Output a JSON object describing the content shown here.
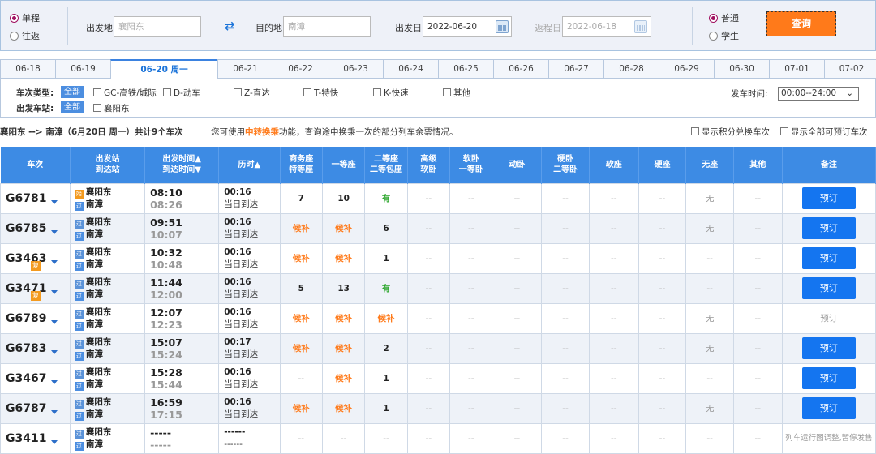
{
  "search": {
    "trip_oneway": "单程",
    "trip_round": "往返",
    "from_label": "出发地",
    "from_value": "襄阳东",
    "to_label": "目的地",
    "to_value": "南漳",
    "depart_label": "出发日",
    "depart_value": "2022-06-20",
    "return_label": "返程日",
    "return_value": "2022-06-18",
    "passenger_normal": "普通",
    "passenger_student": "学生",
    "query_label": "查询"
  },
  "dates": [
    "06-18",
    "06-19",
    "06-20 周一",
    "06-21",
    "06-22",
    "06-23",
    "06-24",
    "06-25",
    "06-26",
    "06-27",
    "06-28",
    "06-29",
    "06-30",
    "07-01",
    "07-02"
  ],
  "filters": {
    "type_label": "车次类型:",
    "all": "全部",
    "types": [
      "GC-高铁/城际",
      "D-动车",
      "Z-直达",
      "T-特快",
      "K-快速",
      "其他"
    ],
    "station_label": "出发车站:",
    "stations": [
      "襄阳东"
    ],
    "time_label": "发车时间:",
    "time_value": "00:00--24:00"
  },
  "info": {
    "route": "襄阳东 --> 南漳（6月20日 周一）共计",
    "count": "9",
    "count_suffix": "个车次",
    "tip_pre": "您可使用",
    "tip_link": "中转换乘",
    "tip_post": "功能，查询途中换乘一次的部分列车余票情况。",
    "opt1": "显示积分兑换车次",
    "opt2": "显示全部可预订车次"
  },
  "headers": {
    "train": "车次",
    "station1": "出发站",
    "station2": "到达站",
    "time1": "出发时间▲",
    "time2": "到达时间▼",
    "duration": "历时▲",
    "business1": "商务座",
    "business2": "特等座",
    "first": "一等座",
    "second1": "二等座",
    "second2": "二等包座",
    "gr1": "高级",
    "gr2": "软卧",
    "sw1": "软卧",
    "sw2": "一等卧",
    "dw": "动卧",
    "hw1": "硬卧",
    "hw2": "二等卧",
    "rz": "软座",
    "yz": "硬座",
    "wz": "无座",
    "other": "其他",
    "remark": "备注"
  },
  "icons": {
    "start": "始",
    "pass": "过",
    "fu": "复"
  },
  "rows": [
    {
      "no": "G6781",
      "fu": false,
      "from": "襄阳东",
      "from_type": "start",
      "to": "南漳",
      "dep": "08:10",
      "arr": "08:26",
      "dur": "00:16",
      "day": "当日到达",
      "biz": "7",
      "first": "10",
      "second": "有",
      "gr": "--",
      "sw": "--",
      "dw": "--",
      "hw": "--",
      "rz": "--",
      "yz": "--",
      "wz": "无",
      "other": "--",
      "book": "预订",
      "bookable": true
    },
    {
      "no": "G6785",
      "fu": false,
      "from": "襄阳东",
      "from_type": "pass",
      "to": "南漳",
      "dep": "09:51",
      "arr": "10:07",
      "dur": "00:16",
      "day": "当日到达",
      "biz": "候补",
      "first": "候补",
      "second": "6",
      "gr": "--",
      "sw": "--",
      "dw": "--",
      "hw": "--",
      "rz": "--",
      "yz": "--",
      "wz": "无",
      "other": "--",
      "book": "预订",
      "bookable": true
    },
    {
      "no": "G3463",
      "fu": true,
      "from": "襄阳东",
      "from_type": "pass",
      "to": "南漳",
      "dep": "10:32",
      "arr": "10:48",
      "dur": "00:16",
      "day": "当日到达",
      "biz": "候补",
      "first": "候补",
      "second": "1",
      "gr": "--",
      "sw": "--",
      "dw": "--",
      "hw": "--",
      "rz": "--",
      "yz": "--",
      "wz": "--",
      "other": "--",
      "book": "预订",
      "bookable": true
    },
    {
      "no": "G3471",
      "fu": true,
      "from": "襄阳东",
      "from_type": "pass",
      "to": "南漳",
      "dep": "11:44",
      "arr": "12:00",
      "dur": "00:16",
      "day": "当日到达",
      "biz": "5",
      "first": "13",
      "second": "有",
      "gr": "--",
      "sw": "--",
      "dw": "--",
      "hw": "--",
      "rz": "--",
      "yz": "--",
      "wz": "--",
      "other": "--",
      "book": "预订",
      "bookable": true
    },
    {
      "no": "G6789",
      "fu": false,
      "from": "襄阳东",
      "from_type": "pass",
      "to": "南漳",
      "dep": "12:07",
      "arr": "12:23",
      "dur": "00:16",
      "day": "当日到达",
      "biz": "候补",
      "first": "候补",
      "second": "候补",
      "gr": "--",
      "sw": "--",
      "dw": "--",
      "hw": "--",
      "rz": "--",
      "yz": "--",
      "wz": "无",
      "other": "--",
      "book": "预订",
      "bookable": false
    },
    {
      "no": "G6783",
      "fu": false,
      "from": "襄阳东",
      "from_type": "pass",
      "to": "南漳",
      "dep": "15:07",
      "arr": "15:24",
      "dur": "00:17",
      "day": "当日到达",
      "biz": "候补",
      "first": "候补",
      "second": "2",
      "gr": "--",
      "sw": "--",
      "dw": "--",
      "hw": "--",
      "rz": "--",
      "yz": "--",
      "wz": "无",
      "other": "--",
      "book": "预订",
      "bookable": true
    },
    {
      "no": "G3467",
      "fu": false,
      "from": "襄阳东",
      "from_type": "pass",
      "to": "南漳",
      "dep": "15:28",
      "arr": "15:44",
      "dur": "00:16",
      "day": "当日到达",
      "biz": "--",
      "first": "候补",
      "second": "1",
      "gr": "--",
      "sw": "--",
      "dw": "--",
      "hw": "--",
      "rz": "--",
      "yz": "--",
      "wz": "--",
      "other": "--",
      "book": "预订",
      "bookable": true
    },
    {
      "no": "G6787",
      "fu": false,
      "from": "襄阳东",
      "from_type": "pass",
      "to": "南漳",
      "dep": "16:59",
      "arr": "17:15",
      "dur": "00:16",
      "day": "当日到达",
      "biz": "候补",
      "first": "候补",
      "second": "1",
      "gr": "--",
      "sw": "--",
      "dw": "--",
      "hw": "--",
      "rz": "--",
      "yz": "--",
      "wz": "无",
      "other": "--",
      "book": "预订",
      "bookable": true
    },
    {
      "no": "G3411",
      "fu": false,
      "from": "襄阳东",
      "from_type": "pass",
      "to": "南漳",
      "dep": "-----",
      "arr": "-----",
      "dur": "------",
      "day": "------",
      "biz": "--",
      "first": "--",
      "second": "--",
      "gr": "--",
      "sw": "--",
      "dw": "--",
      "hw": "--",
      "rz": "--",
      "yz": "--",
      "wz": "--",
      "other": "--",
      "book": "列车运行图调整,暂停发售",
      "bookable": null
    }
  ]
}
